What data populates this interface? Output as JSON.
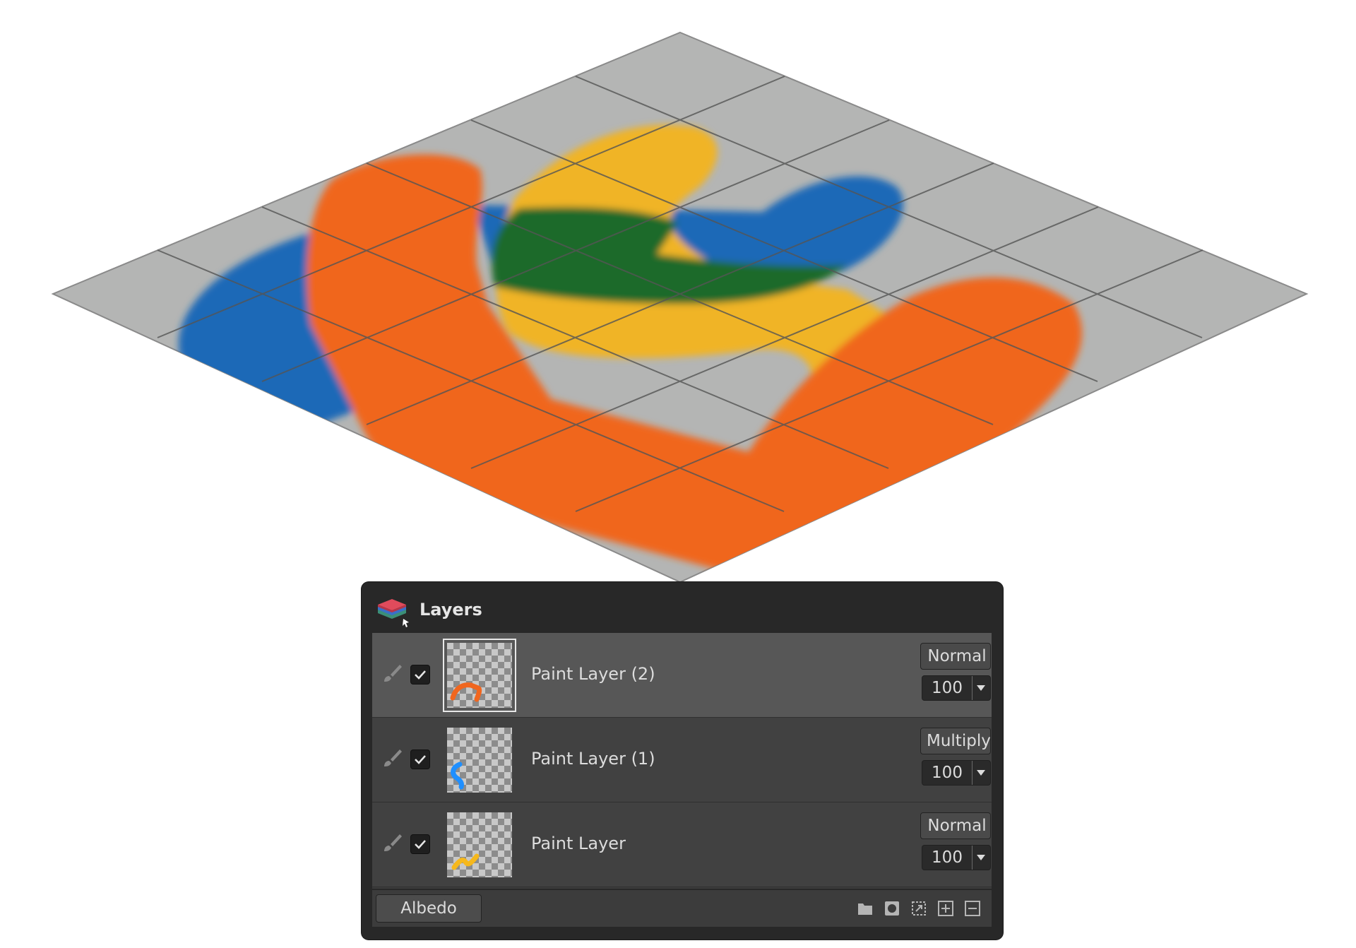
{
  "panel": {
    "title": "Layers",
    "icon": "layers-icon"
  },
  "layers": [
    {
      "name": "Paint Layer (2)",
      "blend_mode": "Normal",
      "opacity": "100",
      "visible": true,
      "selected": true,
      "stroke_color": "#f0661f"
    },
    {
      "name": "Paint Layer (1)",
      "blend_mode": "Multiply",
      "opacity": "100",
      "visible": true,
      "selected": false,
      "stroke_color": "#1f8fff"
    },
    {
      "name": "Paint Layer",
      "blend_mode": "Normal",
      "opacity": "100",
      "visible": true,
      "selected": false,
      "stroke_color": "#f6b81c"
    }
  ],
  "footer": {
    "channel_button": "Albedo",
    "tools": [
      "folder-icon",
      "mask-icon",
      "resize-icon",
      "add-layer-icon",
      "remove-layer-icon"
    ]
  },
  "colors": {
    "ground": "#b4b5b4",
    "orange": "#f0661f",
    "blue": "#1f69b7",
    "yellow": "#f0b428",
    "green": "#1f6a2a"
  }
}
